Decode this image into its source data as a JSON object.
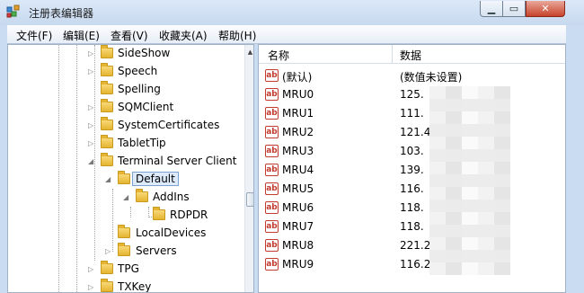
{
  "window": {
    "title": "注册表编辑器"
  },
  "menu": [
    {
      "label": "文件(F)"
    },
    {
      "label": "编辑(E)"
    },
    {
      "label": "查看(V)"
    },
    {
      "label": "收藏夹(A)"
    },
    {
      "label": "帮助(H)"
    }
  ],
  "tree": {
    "items": [
      {
        "label": "SideShow",
        "expander": "▷"
      },
      {
        "label": "Speech",
        "expander": "▷"
      },
      {
        "label": "Spelling",
        "expander": ""
      },
      {
        "label": "SQMClient",
        "expander": "▷"
      },
      {
        "label": "SystemCertificates",
        "expander": "▷"
      },
      {
        "label": "TabletTip",
        "expander": "▷"
      },
      {
        "label": "Terminal Server Client",
        "expander": "◢"
      },
      {
        "label": "Default",
        "expander": "◢",
        "selected": true
      },
      {
        "label": "AddIns",
        "expander": "◢"
      },
      {
        "label": "RDPDR",
        "expander": ""
      },
      {
        "label": "LocalDevices",
        "expander": ""
      },
      {
        "label": "Servers",
        "expander": "▷"
      },
      {
        "label": "TPG",
        "expander": "▷"
      },
      {
        "label": "TXKey",
        "expander": "▷"
      }
    ]
  },
  "list": {
    "columns": {
      "name": "名称",
      "data": "数据"
    },
    "rows": [
      {
        "name": "(默认)",
        "data": "(数值未设置)"
      },
      {
        "name": "MRU0",
        "data": "125."
      },
      {
        "name": "MRU1",
        "data": "111."
      },
      {
        "name": "MRU2",
        "data": "121.4"
      },
      {
        "name": "MRU3",
        "data": "103."
      },
      {
        "name": "MRU4",
        "data": "139."
      },
      {
        "name": "MRU5",
        "data": "116."
      },
      {
        "name": "MRU6",
        "data": "118."
      },
      {
        "name": "MRU7",
        "data": "118."
      },
      {
        "name": "MRU8",
        "data": "221.2"
      },
      {
        "name": "MRU9",
        "data": "116.2"
      }
    ]
  },
  "icons": {
    "app": "registry-editor-icon",
    "folder": "folder-icon",
    "string_value": "string-value-icon"
  },
  "colors": {
    "title_bar": "#c7d9ef",
    "close_button": "#c7432c",
    "selection": "#dceafc",
    "string_icon": "#c23b2e"
  }
}
